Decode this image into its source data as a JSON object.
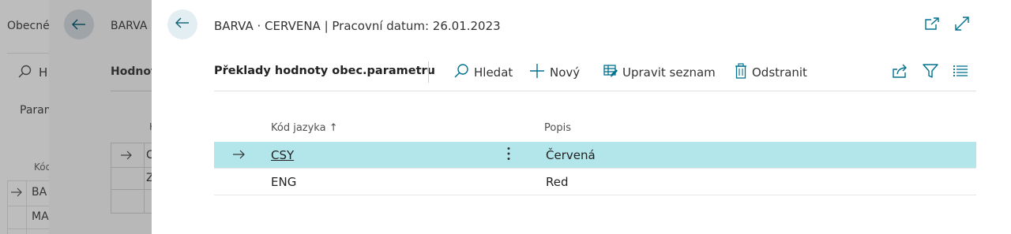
{
  "background_pages": {
    "page1": {
      "tab_label": "Obecné",
      "search_label": "H",
      "section_label": "Param",
      "column_header": "Kód",
      "row_values": [
        "BA",
        "MA"
      ]
    },
    "page2": {
      "title": "BARVA",
      "subpage_caption": "Hodnot",
      "column_header": "K",
      "row_values": [
        "C",
        "Z"
      ]
    }
  },
  "dialog": {
    "title": "BARVA · CERVENA | Pracovní datum: 26.01.2023",
    "header_icons": [
      "open-in-new-window-icon",
      "expand-icon"
    ],
    "toolbar": {
      "caption": "Překlady hodnoty obec.parametru",
      "search_label": "Hledat",
      "new_label": "Nový",
      "edit_list_label": "Upravit seznam",
      "delete_label": "Odstranit",
      "right_icons": [
        "share-icon",
        "filter-icon",
        "list-view-icon"
      ]
    },
    "table": {
      "columns": [
        "Kód jazyka",
        "Popis"
      ],
      "sort_indicator": "↑",
      "rows": [
        {
          "code": "CSY",
          "description": "Červená",
          "selected": true
        },
        {
          "code": "ENG",
          "description": "Red",
          "selected": false
        }
      ]
    }
  },
  "colors": {
    "accent": "#00718f",
    "selected_row": "#b3e6ea",
    "back_button_bg": "#e3eef2"
  }
}
